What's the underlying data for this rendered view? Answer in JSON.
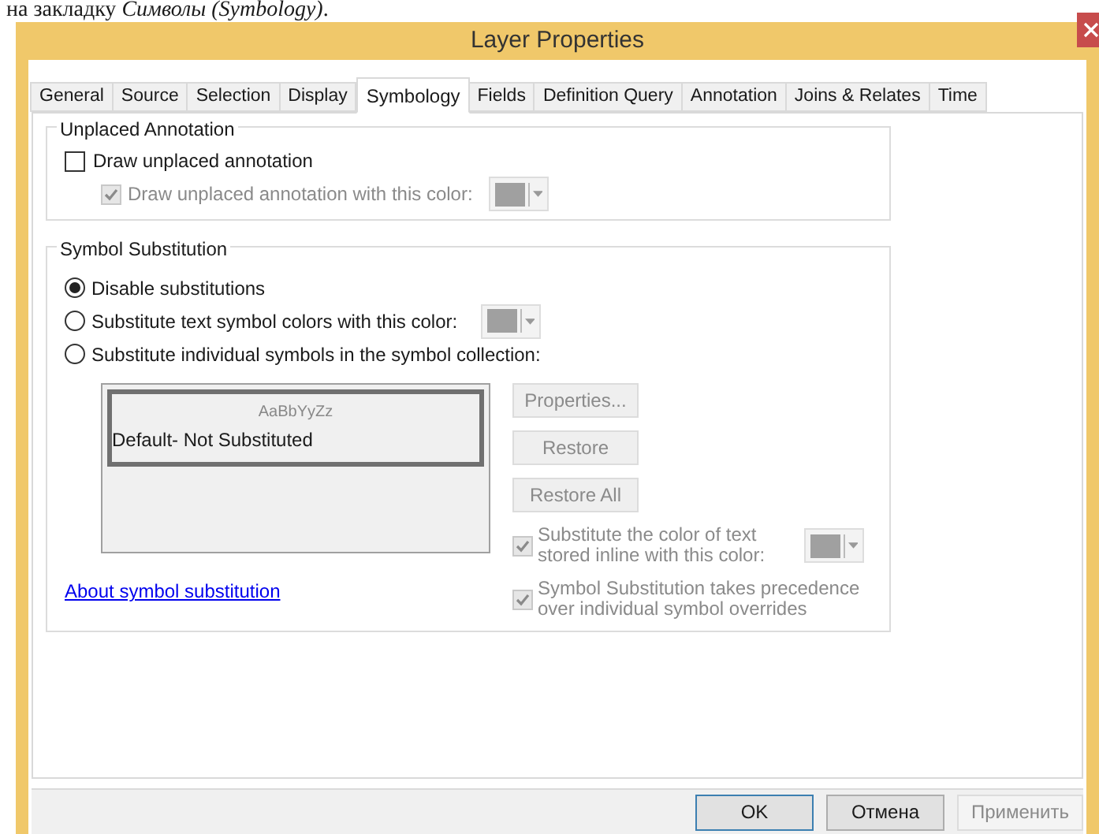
{
  "doc_text": "на закладку *Символы (Symbology)*.",
  "window": {
    "title": "Layer Properties"
  },
  "tabs": [
    {
      "label": "General",
      "selected": false
    },
    {
      "label": "Source",
      "selected": false
    },
    {
      "label": "Selection",
      "selected": false
    },
    {
      "label": "Display",
      "selected": false
    },
    {
      "label": "Symbology",
      "selected": true
    },
    {
      "label": "Fields",
      "selected": false
    },
    {
      "label": "Definition Query",
      "selected": false
    },
    {
      "label": "Annotation",
      "selected": false
    },
    {
      "label": "Joins & Relates",
      "selected": false
    },
    {
      "label": "Time",
      "selected": false
    }
  ],
  "unplaced_annotation": {
    "title": "Unplaced Annotation",
    "draw_unplaced": {
      "label": "Draw unplaced annotation",
      "checked": false,
      "disabled": false
    },
    "draw_with_color": {
      "label": "Draw unplaced annotation with this color:",
      "checked": true,
      "disabled": true
    }
  },
  "symbol_substitution": {
    "title": "Symbol Substitution",
    "options": [
      {
        "label": "Disable substitutions",
        "selected": true
      },
      {
        "label": "Substitute text symbol colors with this color:",
        "selected": false
      },
      {
        "label": "Substitute individual symbols in the symbol collection:",
        "selected": false
      }
    ],
    "symbol_list": [
      {
        "preview": "AaBbYyZz",
        "label": "Default- Not Substituted",
        "selected": true
      }
    ],
    "buttons": [
      {
        "label": "Properties...",
        "disabled": true
      },
      {
        "label": "Restore",
        "disabled": true
      },
      {
        "label": "Restore All",
        "disabled": true
      }
    ],
    "inline_color": {
      "label": "Substitute the color of text\nstored inline with this color:",
      "checked": true,
      "disabled": true
    },
    "precedence": {
      "label": "Symbol Substitution takes precedence\nover individual symbol overrides",
      "checked": true,
      "disabled": true
    },
    "link": "About symbol substitution"
  },
  "dialog_buttons": [
    {
      "label": "OK",
      "default": true,
      "disabled": false
    },
    {
      "label": "Отмена",
      "default": false,
      "disabled": false
    },
    {
      "label": "Применить",
      "default": false,
      "disabled": true
    }
  ]
}
